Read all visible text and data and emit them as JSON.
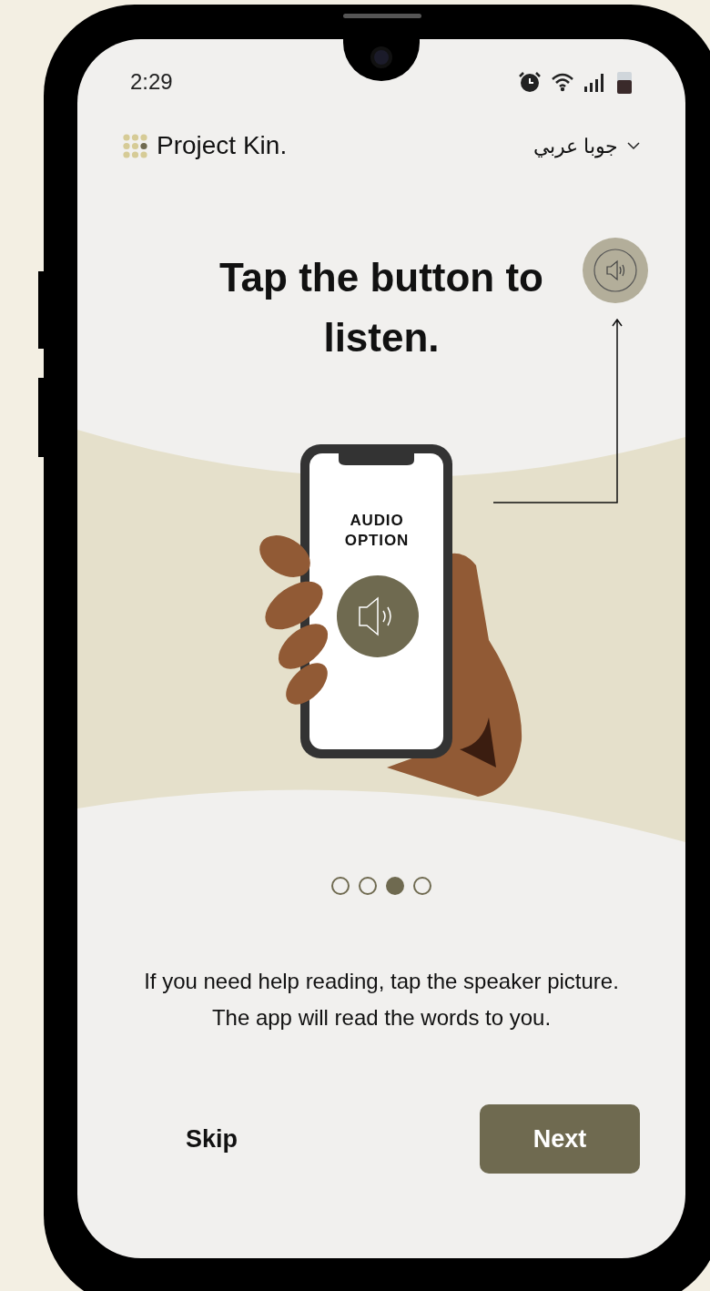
{
  "status_bar": {
    "time": "2:29"
  },
  "header": {
    "brand": "Project Kin.",
    "language": "جوبا عربي"
  },
  "heading": "Tap the button to listen.",
  "illustration": {
    "caption": "AUDIO OPTION"
  },
  "pagination": [
    {
      "selected": false
    },
    {
      "selected": false
    },
    {
      "selected": true
    },
    {
      "selected": false
    }
  ],
  "body": "If you need help reading, tap the speaker picture. The app will read the words to you.",
  "buttons": {
    "skip": "Skip",
    "next": "Next"
  }
}
